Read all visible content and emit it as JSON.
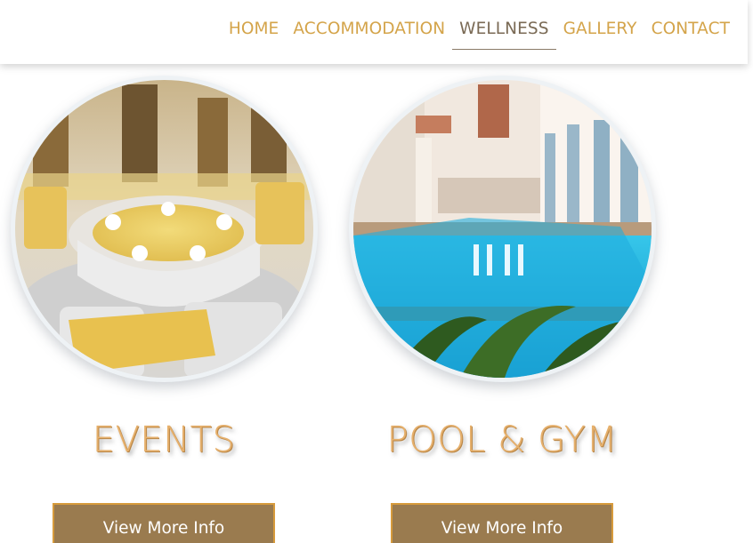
{
  "nav": {
    "items": [
      {
        "label": "HOME",
        "active": false
      },
      {
        "label": "ACCOMMODATION",
        "active": false
      },
      {
        "label": "WELLNESS",
        "active": true
      },
      {
        "label": "GALLERY",
        "active": false
      },
      {
        "label": "CONTACT",
        "active": false
      }
    ]
  },
  "cards": [
    {
      "title": "EVENTS",
      "button_label": "View More Info",
      "image_subject": "banquet hall with round table set in white and gold"
    },
    {
      "title": "POOL & GYM",
      "button_label": "View More Info",
      "image_subject": "indoor swimming pool in a multi-story atrium"
    }
  ],
  "colors": {
    "nav_link": "#d4a44a",
    "nav_active": "#7a6a55",
    "title": "#e6b06c",
    "button_bg": "#9a7b4f",
    "button_border": "#d79b3c"
  }
}
